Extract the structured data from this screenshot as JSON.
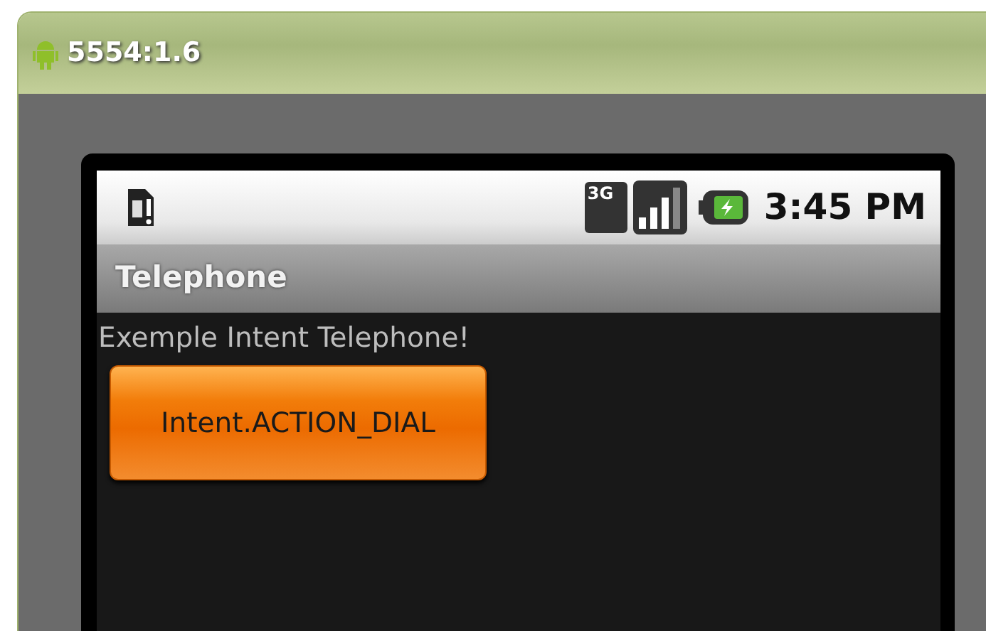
{
  "window": {
    "title": "5554:1.6"
  },
  "status_bar": {
    "time": "3:45 PM",
    "network": "3G"
  },
  "app_bar": {
    "title": "Telephone"
  },
  "content": {
    "text": "Exemple Intent Telephone!",
    "buttons": [
      {
        "label": "Intent.ACTION_DIAL",
        "pressed": true
      }
    ]
  }
}
